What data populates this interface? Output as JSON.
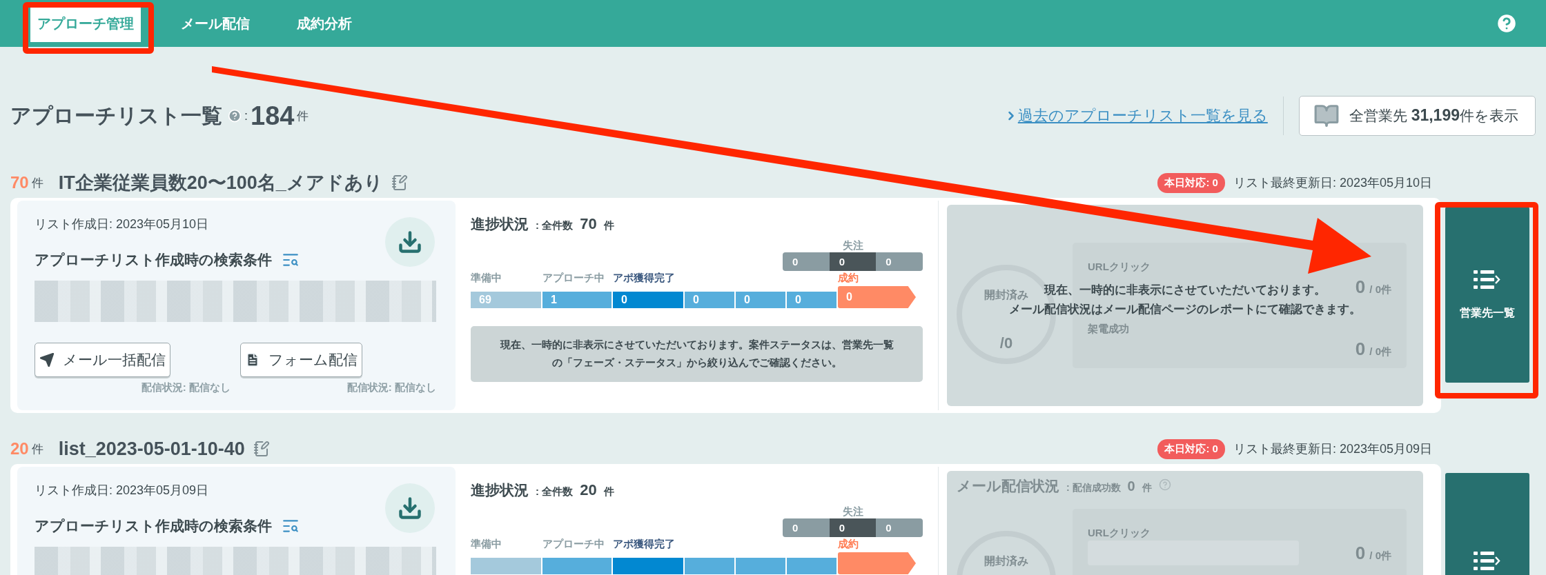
{
  "nav": {
    "tabs": [
      {
        "label": "アプローチ管理",
        "selected": true
      },
      {
        "label": "メール配信",
        "selected": false
      },
      {
        "label": "成約分析",
        "selected": false
      }
    ]
  },
  "header": {
    "title": "アプローチリスト一覧",
    "separator": ":",
    "count": "184",
    "unit": "件",
    "past_link": "過去のアプローチリスト一覧を見る",
    "all_button": {
      "prefix": "全営業先",
      "count": "31,199",
      "suffix": "件を表示"
    }
  },
  "lists": [
    {
      "count": "70",
      "unit": "件",
      "name": "IT企業従業員数20〜100名_メアドあり",
      "today_badge": "本日対応: 0",
      "updated": "リスト最終更新日: 2023年05月10日",
      "created": "リスト作成日: 2023年05月10日",
      "conditions_title": "アプローチリスト作成時の検索条件",
      "actions": [
        {
          "label": "メール一括配信",
          "kind": "mail",
          "status": "配信状況: 配信なし"
        },
        {
          "label": "フォーム配信",
          "kind": "form",
          "status": "配信状況: 配信なし"
        }
      ],
      "progress": {
        "title": "進捗状況",
        "total_label": ": 全件数",
        "total": "70",
        "unit": "件",
        "lost": {
          "label": "失注",
          "values": [
            "0",
            "0",
            "0"
          ]
        },
        "stages": [
          {
            "label": "準備中",
            "value": "69",
            "kind": "prep"
          },
          {
            "label": "アプローチ中",
            "value": "1",
            "kind": "active"
          },
          {
            "label": "アポ獲得完了",
            "value": "0",
            "kind": "current"
          },
          {
            "value": "0",
            "kind": "active"
          },
          {
            "value": "0",
            "kind": "active"
          },
          {
            "value": "0",
            "kind": "active"
          },
          {
            "label": "成約",
            "value": "0",
            "kind": "won"
          }
        ],
        "notice": "現在、一時的に非表示にさせていただいております。案件ステータスは、営業先一覧の「フェーズ・ステータス」から絞り込んでご確認ください。"
      },
      "mail": {
        "opened_label": "開封済み",
        "opened_total": "/0",
        "metrics": [
          {
            "label": "URLクリック",
            "value": "0",
            "total": "/ 0件"
          },
          {
            "label": "架電成功",
            "value": "0",
            "total": "/ 0件"
          }
        ],
        "notice_lines": [
          "現在、一時的に非表示にさせていただいております。",
          "メール配信状況はメール配信ページのレポートにて確認できます。"
        ]
      },
      "side_button": "営業先一覧"
    },
    {
      "count": "20",
      "unit": "件",
      "name": "list_2023-05-01-10-40",
      "today_badge": "本日対応: 0",
      "updated": "リスト最終更新日: 2023年05月09日",
      "created": "リスト作成日: 2023年05月09日",
      "conditions_title": "アプローチリスト作成時の検索条件",
      "progress": {
        "title": "進捗状況",
        "total_label": ": 全件数",
        "total": "20",
        "unit": "件",
        "lost": {
          "label": "失注",
          "values": [
            "0",
            "0",
            "0"
          ]
        },
        "stages": [
          {
            "label": "準備中",
            "kind": "prep"
          },
          {
            "label": "アプローチ中",
            "kind": "active"
          },
          {
            "label": "アポ獲得完了",
            "kind": "current"
          },
          {
            "kind": "active"
          },
          {
            "kind": "active"
          },
          {
            "kind": "active"
          },
          {
            "label": "成約",
            "kind": "won"
          }
        ]
      },
      "mail": {
        "title": "メール配信状況",
        "success_label": ": 配信成功数",
        "success": "0",
        "success_unit": "件",
        "opened_label": "開封済み",
        "metrics": [
          {
            "label": "URLクリック",
            "value": "0",
            "total": "/ 0件"
          }
        ]
      }
    }
  ]
}
